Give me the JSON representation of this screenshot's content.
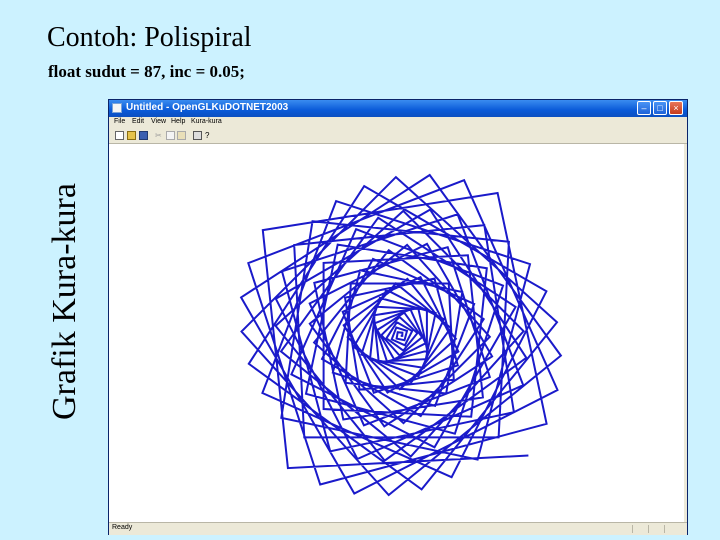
{
  "slide": {
    "title": "Contoh: Polispiral",
    "subtitle": "float sudut = 87, inc = 0.05;",
    "side_title": "Grafik Kura-kura"
  },
  "window": {
    "title": "Untitled - OpenGLKuDOTNET2003",
    "menu": [
      "File",
      "Edit",
      "View",
      "Help",
      "Kura-kura"
    ],
    "status": "Ready"
  },
  "toolbar": {
    "icons": [
      "new-file-icon",
      "open-folder-icon",
      "save-icon",
      "cut-icon",
      "copy-icon",
      "paste-icon",
      "print-icon",
      "help-icon"
    ]
  },
  "polispiral": {
    "angle_deg": 87,
    "increment": 0.05,
    "line_color": "#1a1aca"
  },
  "colors": {
    "slide_background": "#ccf2ff",
    "titlebar": "#0a5ad8"
  }
}
